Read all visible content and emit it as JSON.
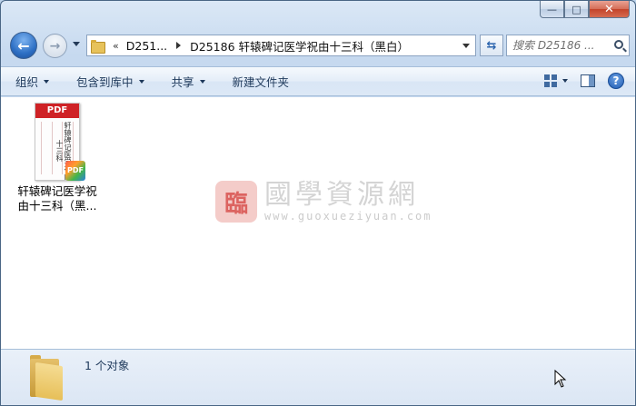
{
  "window": {
    "caption": {
      "minimize": "—",
      "maximize": "□",
      "close": "✕"
    }
  },
  "nav": {
    "back_glyph": "←",
    "forward_glyph": "→",
    "refresh_glyph": "⇆"
  },
  "address": {
    "overflow": "«",
    "crumbs": [
      "D251...",
      "D25186 轩辕碑记医学祝由十三科（黑白）"
    ]
  },
  "search": {
    "placeholder": "搜索 D25186 ..."
  },
  "commands": [
    "组织",
    "包含到库中",
    "共享",
    "新建文件夹"
  ],
  "help_glyph": "?",
  "file": {
    "badge_head": "PDF",
    "thumb_text": "轩辕碑记医学祝由十三科",
    "badge": "PDF",
    "label_line1": "轩辕碑记医学祝",
    "label_line2": "由十三科（黑..."
  },
  "watermark": {
    "seal": "臨",
    "text_cn": "國學資源網",
    "url": "www.guoxueziyuan.com"
  },
  "status": {
    "text": "1 个对象"
  }
}
